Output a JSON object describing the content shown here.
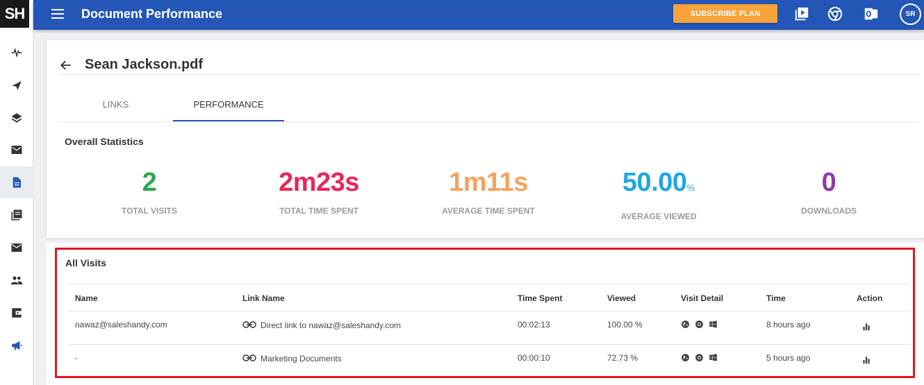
{
  "app": {
    "logo_text": "SH",
    "title": "Document Performance",
    "subscribe_label": "SUBSCRIBE PLAN",
    "avatar_initials": "SR",
    "brand_color": "#2456b8",
    "accent_color": "#f7a33a"
  },
  "sidebar": {
    "items": [
      {
        "icon": "activity-icon"
      },
      {
        "icon": "paper-plane-icon"
      },
      {
        "icon": "layers-icon"
      },
      {
        "icon": "email-icon"
      },
      {
        "icon": "document-icon",
        "active": true
      },
      {
        "icon": "library-icon"
      },
      {
        "icon": "mail-icon"
      },
      {
        "icon": "people-icon"
      },
      {
        "icon": "wallet-icon"
      },
      {
        "icon": "megaphone-icon"
      }
    ]
  },
  "document": {
    "title": "Sean Jackson.pdf",
    "tabs": [
      {
        "label": "LINKS",
        "active": false
      },
      {
        "label": "PERFORMANCE",
        "active": true
      }
    ]
  },
  "overall": {
    "title": "Overall Statistics",
    "stats": [
      {
        "value": "2",
        "label": "TOTAL VISITS",
        "color": "#2ea44f"
      },
      {
        "value": "2m23s",
        "label": "TOTAL TIME SPENT",
        "color": "#e8275a"
      },
      {
        "value": "1m11s",
        "label": "AVERAGE TIME SPENT",
        "color": "#f5a25d"
      },
      {
        "value": "50.00",
        "unit": "%",
        "label": "AVERAGE VIEWED",
        "color": "#1ea7e1"
      },
      {
        "value": "0",
        "label": "DOWNLOADS",
        "color": "#8e3ca8"
      }
    ]
  },
  "visits": {
    "title": "All Visits",
    "columns": [
      "Name",
      "Link Name",
      "Time Spent",
      "Viewed",
      "Visit Detail",
      "Time",
      "Action"
    ],
    "rows": [
      {
        "name": "nawaz@saleshandy.com",
        "link_name": "Direct link to nawaz@saleshandy.com",
        "time_spent": "00:02:13",
        "viewed": "100.00 %",
        "visit_detail": [
          "globe-icon",
          "chrome-icon",
          "windows-icon"
        ],
        "time": "8 hours ago",
        "action": "bar-chart-icon"
      },
      {
        "name": "-",
        "link_name": "Marketing Documents",
        "time_spent": "00:00:10",
        "viewed": "72.73 %",
        "visit_detail": [
          "globe-icon",
          "chrome-icon",
          "windows-icon"
        ],
        "time": "5 hours ago",
        "action": "bar-chart-icon"
      }
    ]
  }
}
